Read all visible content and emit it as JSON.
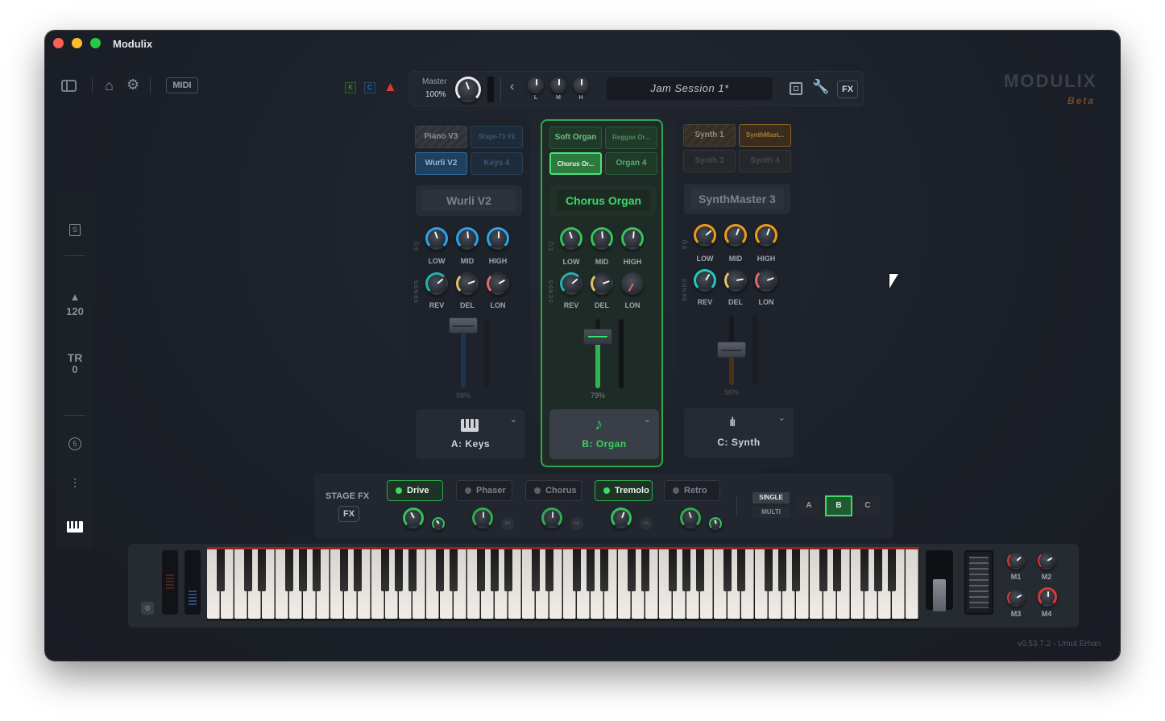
{
  "window": {
    "title": "Modulix"
  },
  "toolbar": {
    "midi": "MIDI",
    "indicators": [
      "K",
      "C"
    ],
    "master_label": "Master",
    "master_value": "100%",
    "eq": [
      "L",
      "M",
      "H"
    ],
    "session": "Jam Session 1*",
    "fx": "FX"
  },
  "brand": {
    "name": "MODULIX",
    "tag": "Beta"
  },
  "sidebar": {
    "s": "S",
    "tempo": "120",
    "tr_label": "TR",
    "tr_value": "0",
    "five": "5"
  },
  "channels": [
    {
      "presets": [
        "Piano V3",
        "Stage-73 V2",
        "Wurli V2",
        "Keys 4"
      ],
      "name": "Wurli V2",
      "eq": [
        "LOW",
        "MID",
        "HIGH"
      ],
      "sends": [
        "REV",
        "DEL",
        "LON"
      ],
      "fader": "98%",
      "slot": "A: Keys",
      "accent": "#2aa3e8"
    },
    {
      "presets": [
        "Soft Organ",
        "Reggae Or...",
        "Chorus Or...",
        "Organ 4"
      ],
      "name": "Chorus Organ",
      "eq": [
        "LOW",
        "MID",
        "HIGH"
      ],
      "sends": [
        "REV",
        "DEL",
        "LON"
      ],
      "fader": "79%",
      "slot": "B: Organ",
      "accent": "#35c25a"
    },
    {
      "presets": [
        "Synth 1",
        "SynthMast...",
        "Synth 3",
        "Synth 4"
      ],
      "name": "SynthMaster 3",
      "eq": [
        "LOW",
        "MID",
        "HIGH"
      ],
      "sends": [
        "REV",
        "DEL",
        "LON"
      ],
      "fader": "56%",
      "slot": "C: Synth",
      "accent": "#f09a1a"
    }
  ],
  "vlabels": {
    "eq": "EQ",
    "sends": "SENDS"
  },
  "stagefx": {
    "label": "STAGE FX",
    "fx": "FX",
    "effects": [
      "Drive",
      "Phaser",
      "Chorus",
      "Tremolo",
      "Retro"
    ],
    "single": "SINGLE",
    "multi": "MULTI",
    "targets": [
      "A",
      "B",
      "C"
    ]
  },
  "mod": {
    "knobs": [
      "M1",
      "M2",
      "M3",
      "M4"
    ]
  },
  "footer": {
    "version": "v0.53.7.2 - Umut Erhan"
  }
}
